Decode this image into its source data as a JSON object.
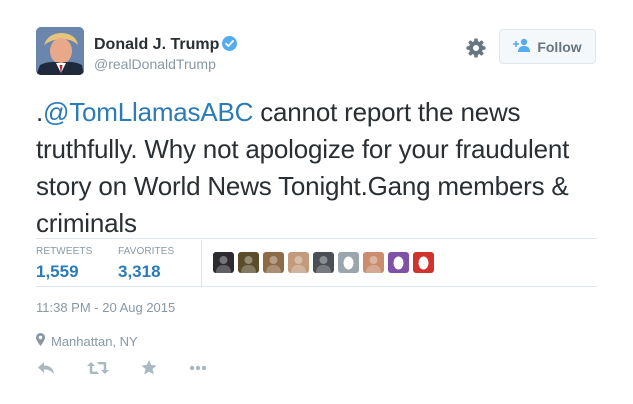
{
  "user": {
    "name": "Donald J. Trump",
    "handle": "@realDonaldTrump",
    "verified": true
  },
  "follow_button": {
    "label": "Follow"
  },
  "tweet": {
    "prefix": ".",
    "mention": "@TomLlamasABC",
    "text": " cannot report the news truthfully. Why not apologize for your fraudulent story on World News Tonight.Gang members & criminals"
  },
  "stats": {
    "retweets_label": "RETWEETS",
    "retweets_value": "1,559",
    "favorites_label": "FAVORITES",
    "favorites_value": "3,318"
  },
  "favoriters": [
    {
      "icon": "favoriter-avatar",
      "color": "#2d2b2f"
    },
    {
      "icon": "favoriter-avatar",
      "color": "#5a4e2a"
    },
    {
      "icon": "favoriter-avatar",
      "color": "#8e6a47"
    },
    {
      "icon": "favoriter-avatar",
      "color": "#c39a7a"
    },
    {
      "icon": "favoriter-avatar",
      "color": "#4a4f56"
    },
    {
      "icon": "default-egg-avatar",
      "color": "#9aa5ad"
    },
    {
      "icon": "favoriter-avatar",
      "color": "#c98c6e"
    },
    {
      "icon": "default-egg-avatar",
      "color": "#7e50a8"
    },
    {
      "icon": "default-egg-avatar",
      "color": "#d0322f"
    }
  ],
  "timestamp": "11:38 PM - 20 Aug 2015",
  "location": "Manhattan, NY",
  "colors": {
    "link": "#2b7bb9",
    "muted": "#8899a6",
    "verified": "#55acee",
    "text": "#292f33"
  },
  "icons": [
    "gear-icon",
    "add-user-icon",
    "verified-badge-icon",
    "location-pin-icon",
    "reply-icon",
    "retweet-icon",
    "favorite-star-icon",
    "more-icon"
  ]
}
